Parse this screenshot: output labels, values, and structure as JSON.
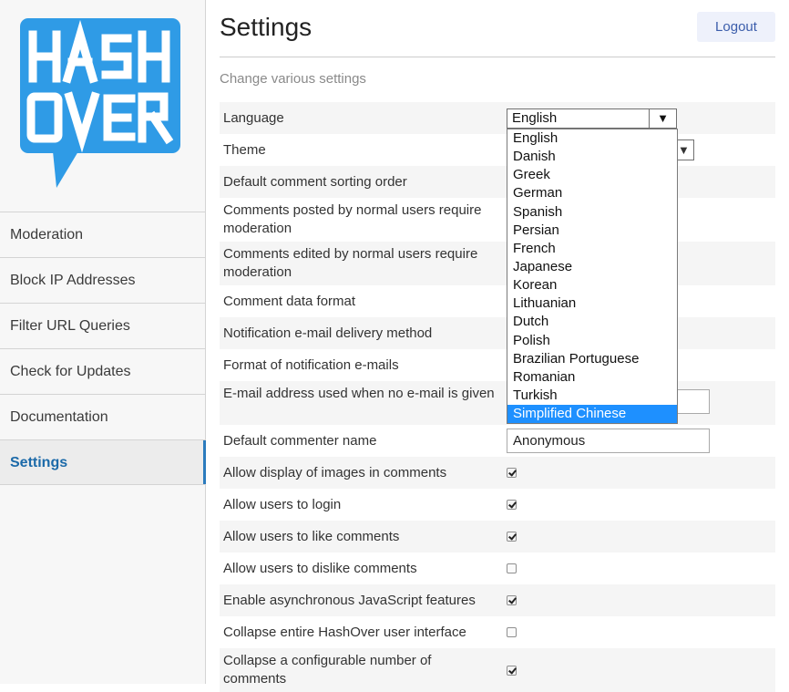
{
  "sidebar": {
    "logo_text": [
      "HASH",
      "OVER"
    ],
    "items": [
      {
        "label": "Moderation",
        "active": false
      },
      {
        "label": "Block IP Addresses",
        "active": false
      },
      {
        "label": "Filter URL Queries",
        "active": false
      },
      {
        "label": "Check for Updates",
        "active": false
      },
      {
        "label": "Documentation",
        "active": false
      },
      {
        "label": "Settings",
        "active": true
      }
    ]
  },
  "header": {
    "title": "Settings",
    "logout_label": "Logout",
    "subtitle": "Change various settings"
  },
  "settings": {
    "language": {
      "label": "Language",
      "value": "English"
    },
    "theme": {
      "label": "Theme"
    },
    "sort_order": {
      "label": "Default comment sorting order"
    },
    "posted_moderation": {
      "label": "Comments posted by normal users require moderation"
    },
    "edited_moderation": {
      "label": "Comments edited by normal users require moderation"
    },
    "data_format": {
      "label": "Comment data format"
    },
    "email_delivery": {
      "label": "Notification e-mail delivery method"
    },
    "email_format": {
      "label": "Format of notification e-mails"
    },
    "no_email_address": {
      "label": "E-mail address used when no e-mail is given"
    },
    "default_name": {
      "label": "Default commenter name",
      "value": "Anonymous"
    },
    "allow_images": {
      "label": "Allow display of images in comments",
      "checked": true
    },
    "allow_login": {
      "label": "Allow users to login",
      "checked": true
    },
    "allow_likes": {
      "label": "Allow users to like comments",
      "checked": true
    },
    "allow_dislikes": {
      "label": "Allow users to dislike comments",
      "checked": false
    },
    "async_js": {
      "label": "Enable asynchronous JavaScript features",
      "checked": true
    },
    "collapse_ui": {
      "label": "Collapse entire HashOver user interface",
      "checked": false
    },
    "collapse_number": {
      "label": "Collapse a configurable number of comments",
      "checked": true
    }
  },
  "language_dropdown": {
    "options": [
      "English",
      "Danish",
      "Greek",
      "German",
      "Spanish",
      "Persian",
      "French",
      "Japanese",
      "Korean",
      "Lithuanian",
      "Dutch",
      "Polish",
      "Brazilian Portuguese",
      "Romanian",
      "Turkish",
      "Simplified Chinese"
    ],
    "highlighted": "Simplified Chinese"
  },
  "icons": {
    "dropdown_arrow": "▼"
  },
  "colors": {
    "accent": "#2b7bbd",
    "logo": "#2f9be6",
    "highlight": "#1e90ff"
  }
}
